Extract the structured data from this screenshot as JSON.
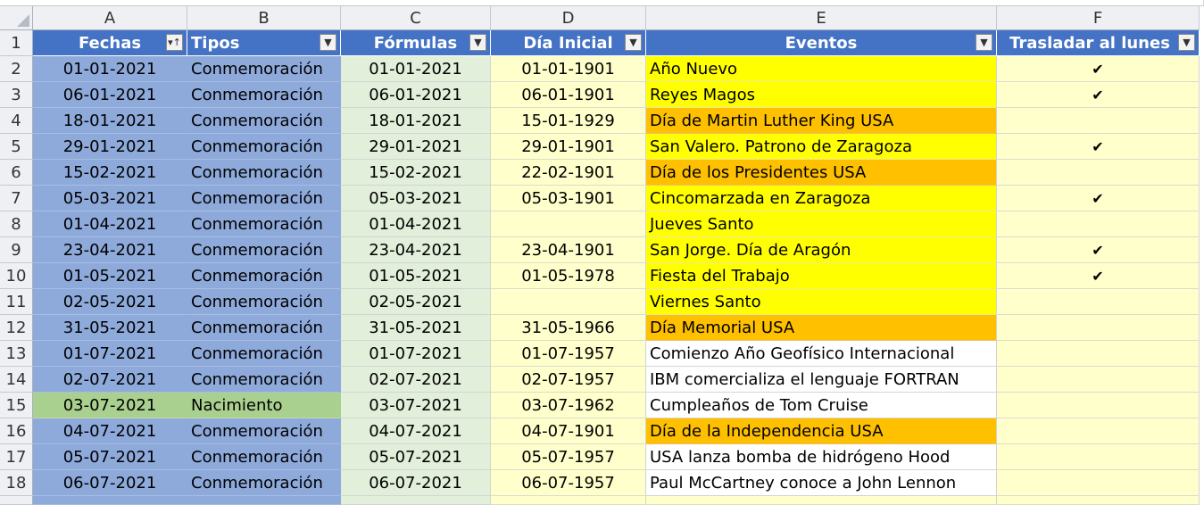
{
  "columns": [
    "A",
    "B",
    "C",
    "D",
    "E",
    "F"
  ],
  "headers": {
    "fechas": "Fechas",
    "tipos": "Tipos",
    "formulas": "Fórmulas",
    "dia_inicial": "Día Inicial",
    "eventos": "Eventos",
    "trasladar": "Trasladar al lunes",
    "row_number": "1"
  },
  "icons": {
    "filter_sorted": "filter-sort-icon",
    "filter": "filter-dropdown-icon",
    "check": "checkmark-icon",
    "comment": "comment-indicator-icon"
  },
  "colors": {
    "header": "#4472c4",
    "tipo_conmemoracion": "#8eaadb",
    "tipo_nacimiento": "#a9d08e",
    "formulas_column": "#e2efda",
    "cream": "#ffffcc",
    "event_yellow": "#ffff00",
    "event_orange": "#ffc000"
  },
  "rows": [
    {
      "num": "2",
      "fecha": "01-01-2021",
      "tipo": "Conmemoración",
      "formula": "01-01-2021",
      "dia_inicial": "01-01-1901",
      "evento": "Año Nuevo",
      "trasladar": "✔",
      "evento_color": "yellow",
      "tipo_color": "blue",
      "comment": false
    },
    {
      "num": "3",
      "fecha": "06-01-2021",
      "tipo": "Conmemoración",
      "formula": "06-01-2021",
      "dia_inicial": "06-01-1901",
      "evento": "Reyes Magos",
      "trasladar": "✔",
      "evento_color": "yellow",
      "tipo_color": "blue",
      "comment": false
    },
    {
      "num": "4",
      "fecha": "18-01-2021",
      "tipo": "Conmemoración",
      "formula": "18-01-2021",
      "dia_inicial": "15-01-1929",
      "evento": "Día de Martin Luther King USA",
      "trasladar": "",
      "evento_color": "orange",
      "tipo_color": "blue",
      "comment": true
    },
    {
      "num": "5",
      "fecha": "29-01-2021",
      "tipo": "Conmemoración",
      "formula": "29-01-2021",
      "dia_inicial": "29-01-1901",
      "evento": "San Valero. Patrono de Zaragoza",
      "trasladar": "✔",
      "evento_color": "yellow",
      "tipo_color": "blue",
      "comment": false
    },
    {
      "num": "6",
      "fecha": "15-02-2021",
      "tipo": "Conmemoración",
      "formula": "15-02-2021",
      "dia_inicial": "22-02-1901",
      "evento": "Día de los Presidentes USA",
      "trasladar": "",
      "evento_color": "orange",
      "tipo_color": "blue",
      "comment": true
    },
    {
      "num": "7",
      "fecha": "05-03-2021",
      "tipo": "Conmemoración",
      "formula": "05-03-2021",
      "dia_inicial": "05-03-1901",
      "evento": "Cincomarzada en Zaragoza",
      "trasladar": "✔",
      "evento_color": "yellow",
      "tipo_color": "blue",
      "comment": false
    },
    {
      "num": "8",
      "fecha": "01-04-2021",
      "tipo": "Conmemoración",
      "formula": "01-04-2021",
      "dia_inicial": "",
      "evento": "Jueves Santo",
      "trasladar": "",
      "evento_color": "yellow",
      "tipo_color": "blue",
      "comment": true
    },
    {
      "num": "9",
      "fecha": "23-04-2021",
      "tipo": "Conmemoración",
      "formula": "23-04-2021",
      "dia_inicial": "23-04-1901",
      "evento": "San Jorge. Día de Aragón",
      "trasladar": "✔",
      "evento_color": "yellow",
      "tipo_color": "blue",
      "comment": false
    },
    {
      "num": "10",
      "fecha": "01-05-2021",
      "tipo": "Conmemoración",
      "formula": "01-05-2021",
      "dia_inicial": "01-05-1978",
      "evento": "Fiesta del Trabajo",
      "trasladar": "✔",
      "evento_color": "yellow",
      "tipo_color": "blue",
      "comment": false
    },
    {
      "num": "11",
      "fecha": "02-05-2021",
      "tipo": "Conmemoración",
      "formula": "02-05-2021",
      "dia_inicial": "",
      "evento": "Viernes Santo",
      "trasladar": "",
      "evento_color": "yellow",
      "tipo_color": "blue",
      "comment": false
    },
    {
      "num": "12",
      "fecha": "31-05-2021",
      "tipo": "Conmemoración",
      "formula": "31-05-2021",
      "dia_inicial": "31-05-1966",
      "evento": "Día Memorial USA",
      "trasladar": "",
      "evento_color": "orange",
      "tipo_color": "blue",
      "comment": false
    },
    {
      "num": "13",
      "fecha": "01-07-2021",
      "tipo": "Conmemoración",
      "formula": "01-07-2021",
      "dia_inicial": "01-07-1957",
      "evento": "Comienzo Año Geofísico Internacional",
      "trasladar": "",
      "evento_color": "white",
      "tipo_color": "blue",
      "comment": false
    },
    {
      "num": "14",
      "fecha": "02-07-2021",
      "tipo": "Conmemoración",
      "formula": "02-07-2021",
      "dia_inicial": "02-07-1957",
      "evento": "IBM comercializa el lenguaje FORTRAN",
      "trasladar": "",
      "evento_color": "white",
      "tipo_color": "blue",
      "comment": false
    },
    {
      "num": "15",
      "fecha": "03-07-2021",
      "tipo": "Nacimiento",
      "formula": "03-07-2021",
      "dia_inicial": "03-07-1962",
      "evento": "Cumpleaños de Tom Cruise",
      "trasladar": "",
      "evento_color": "white",
      "tipo_color": "green",
      "comment": false
    },
    {
      "num": "16",
      "fecha": "04-07-2021",
      "tipo": "Conmemoración",
      "formula": "04-07-2021",
      "dia_inicial": "04-07-1901",
      "evento": "Día de la Independencia USA",
      "trasladar": "",
      "evento_color": "orange",
      "tipo_color": "blue",
      "comment": true
    },
    {
      "num": "17",
      "fecha": "05-07-2021",
      "tipo": "Conmemoración",
      "formula": "05-07-2021",
      "dia_inicial": "05-07-1957",
      "evento": "USA lanza bomba de hidrógeno Hood",
      "trasladar": "",
      "evento_color": "white",
      "tipo_color": "blue",
      "comment": false
    },
    {
      "num": "18",
      "fecha": "06-07-2021",
      "tipo": "Conmemoración",
      "formula": "06-07-2021",
      "dia_inicial": "06-07-1957",
      "evento": "Paul McCartney conoce a John Lennon",
      "trasladar": "",
      "evento_color": "white",
      "tipo_color": "blue",
      "comment": false
    }
  ]
}
